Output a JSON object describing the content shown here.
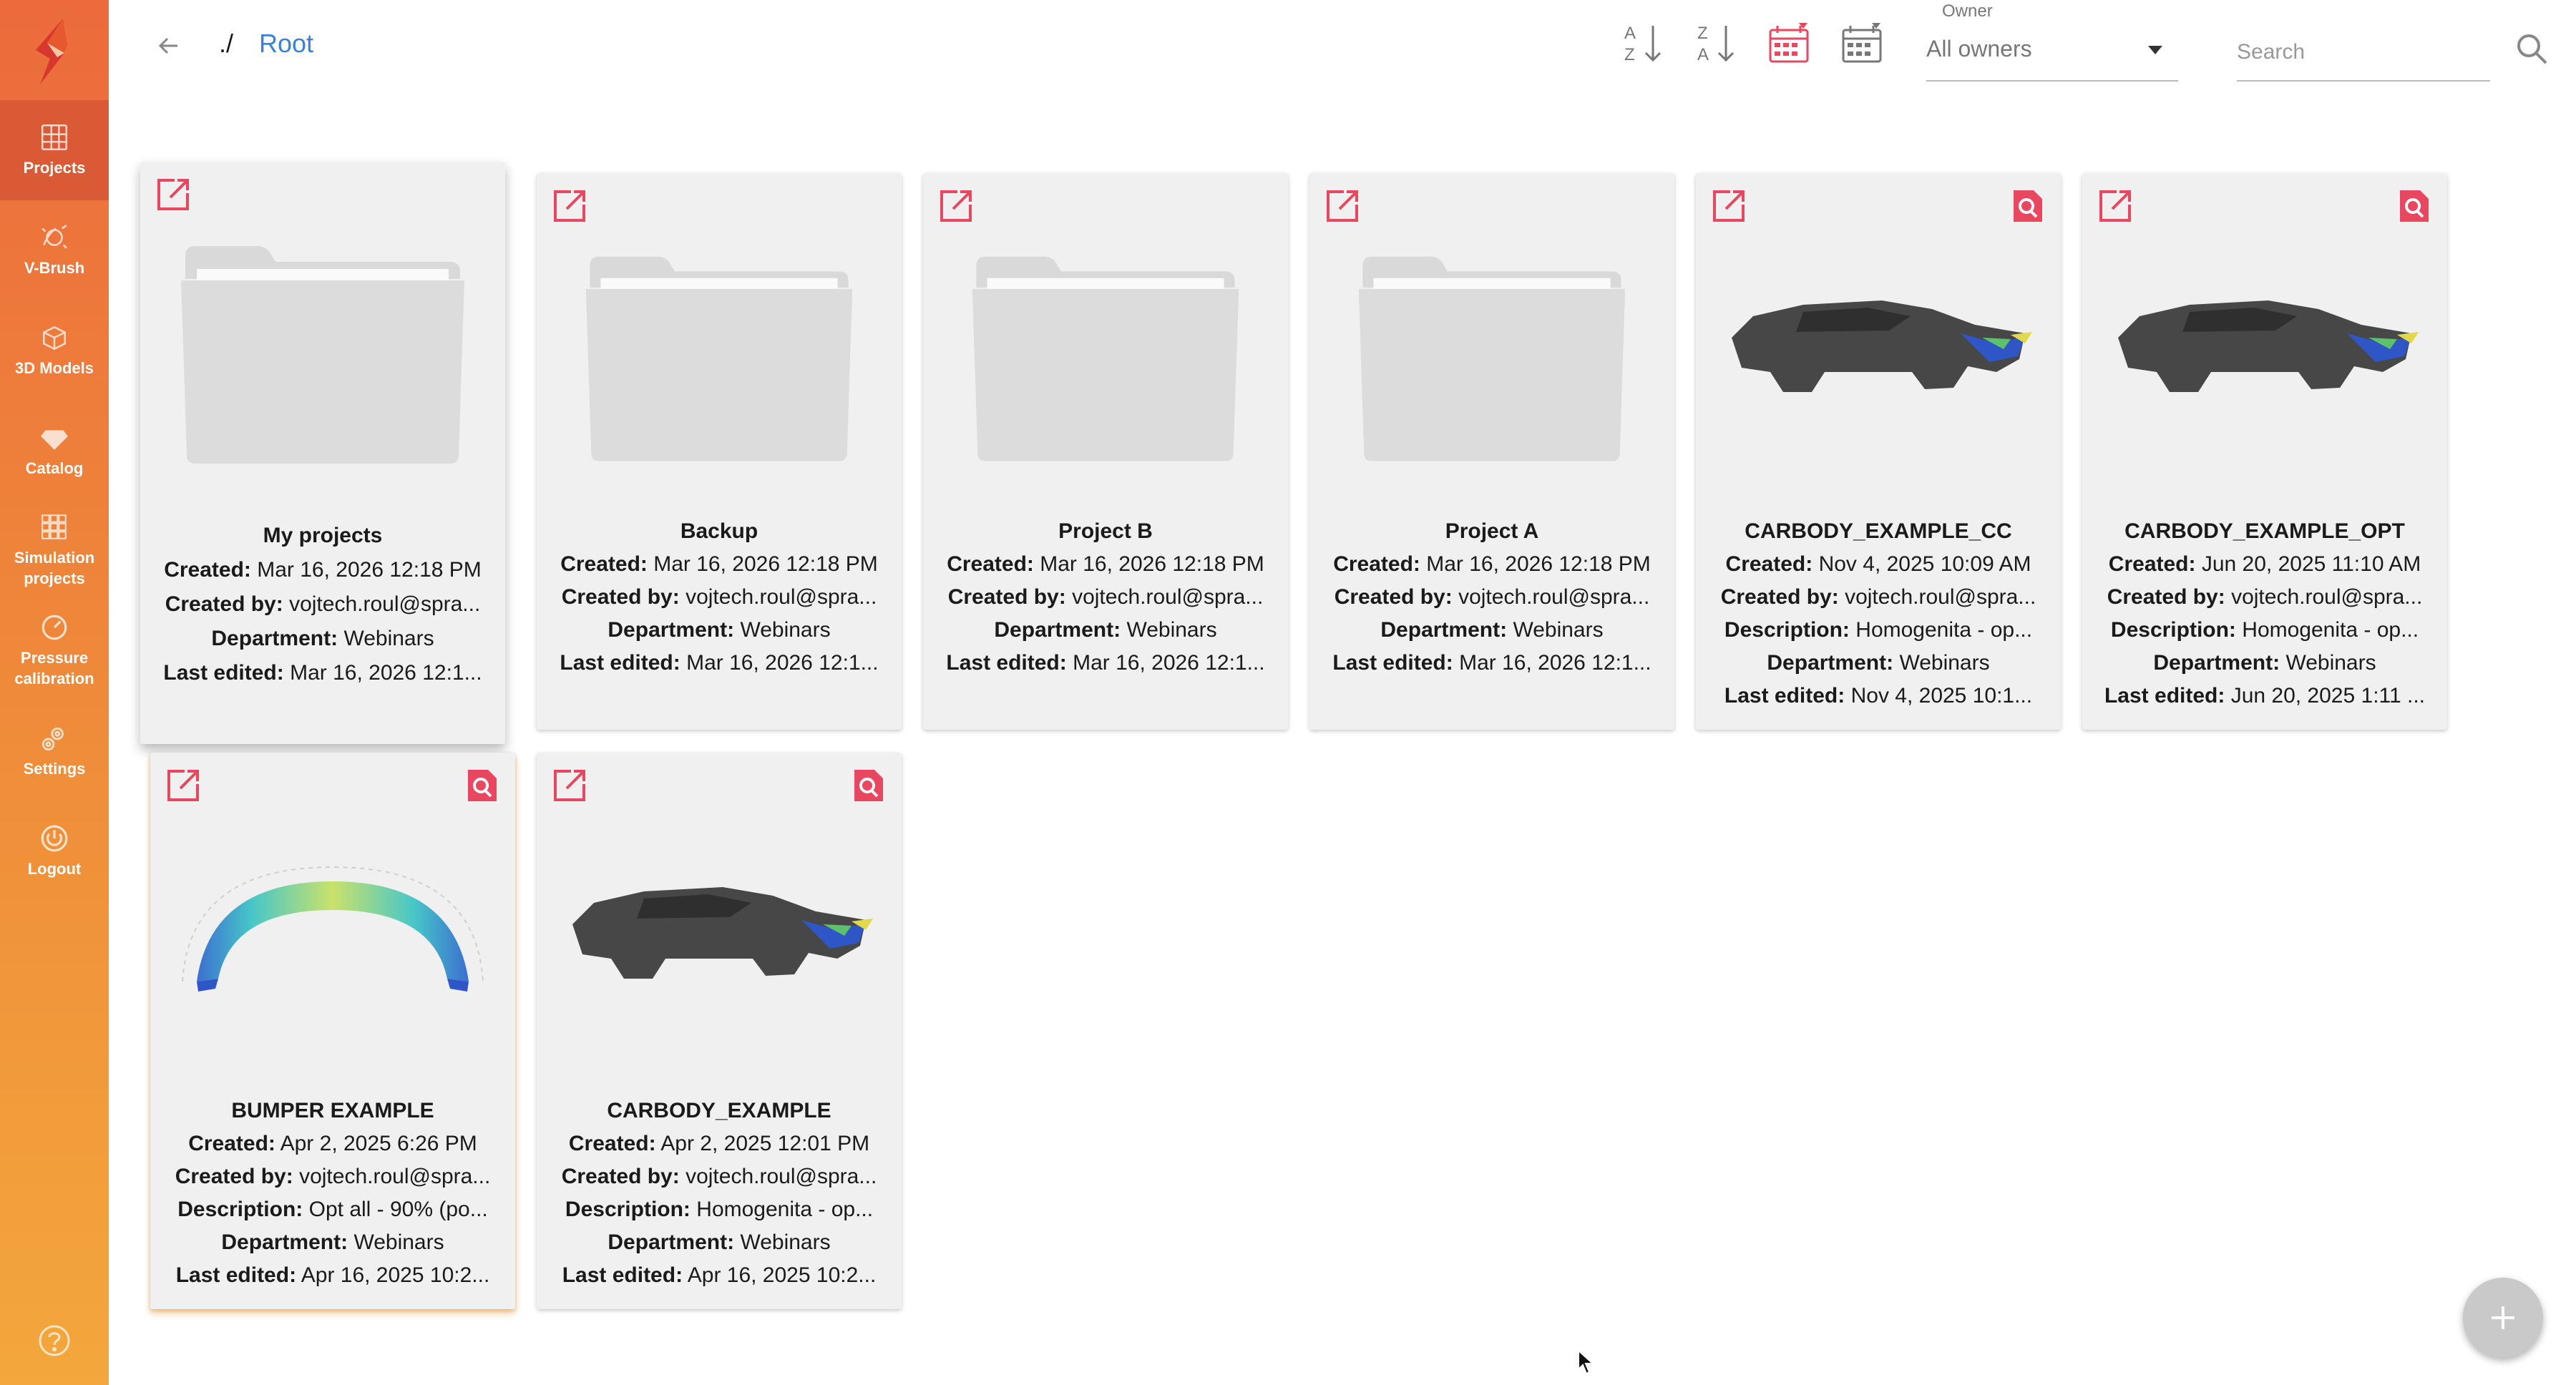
{
  "sidebar": {
    "items": [
      {
        "label": "Projects",
        "icon": "grid-icon",
        "active": true
      },
      {
        "label": "V-Brush",
        "icon": "brush-icon"
      },
      {
        "label": "3D Models",
        "icon": "cube-icon"
      },
      {
        "label": "Catalog",
        "icon": "diamond-icon"
      },
      {
        "label": "Simulation projects",
        "icon": "simulation-grid-icon"
      },
      {
        "label": "Pressure calibration",
        "icon": "gauge-icon"
      },
      {
        "label": "Settings",
        "icon": "gear-icon"
      },
      {
        "label": "Logout",
        "icon": "power-icon"
      }
    ]
  },
  "breadcrumb": {
    "separator": "./",
    "root": "Root"
  },
  "toolbar": {
    "sort_az": "sort-az-icon",
    "sort_za": "sort-za-icon",
    "sort_date_desc": "calendar-sort-down-icon",
    "sort_date_asc": "calendar-sort-up-icon"
  },
  "owner": {
    "label": "Owner",
    "value": "All owners"
  },
  "search": {
    "placeholder": "Search"
  },
  "labels": {
    "created": "Created:",
    "created_by": "Created by:",
    "description": "Description:",
    "department": "Department:",
    "last_edited": "Last edited:"
  },
  "cards": [
    {
      "title": "My projects",
      "created": "Mar 16, 2026 12:18 PM",
      "created_by": "vojtech.roul@spra...",
      "department": "Webinars",
      "last_edited": "Mar 16, 2026 12:1..."
    },
    {
      "title": "Backup",
      "created": "Mar 16, 2026 12:18 PM",
      "created_by": "vojtech.roul@spra...",
      "department": "Webinars",
      "last_edited": "Mar 16, 2026 12:1..."
    },
    {
      "title": "Project B",
      "created": "Mar 16, 2026 12:18 PM",
      "created_by": "vojtech.roul@spra...",
      "department": "Webinars",
      "last_edited": "Mar 16, 2026 12:1..."
    },
    {
      "title": "Project A",
      "created": "Mar 16, 2026 12:18 PM",
      "created_by": "vojtech.roul@spra...",
      "department": "Webinars",
      "last_edited": "Mar 16, 2026 12:1..."
    },
    {
      "title": "CARBODY_EXAMPLE_CC",
      "created": "Nov 4, 2025 10:09 AM",
      "created_by": "vojtech.roul@spra...",
      "description": "Homogenita - op...",
      "department": "Webinars",
      "last_edited": "Nov 4, 2025 10:1..."
    },
    {
      "title": "CARBODY_EXAMPLE_OPT",
      "created": "Jun 20, 2025 11:10 AM",
      "created_by": "vojtech.roul@spra...",
      "description": "Homogenita - op...",
      "department": "Webinars",
      "last_edited": "Jun 20, 2025 1:11 ..."
    },
    {
      "title": "BUMPER EXAMPLE",
      "created": "Apr 2, 2025 6:26 PM",
      "created_by": "vojtech.roul@spra...",
      "description": "Opt all - 90% (po...",
      "department": "Webinars",
      "last_edited": "Apr 16, 2025 10:2..."
    },
    {
      "title": "CARBODY_EXAMPLE",
      "created": "Apr 2, 2025 12:01 PM",
      "created_by": "vojtech.roul@spra...",
      "description": "Homogenita - op...",
      "department": "Webinars",
      "last_edited": "Apr 16, 2025 10:2..."
    }
  ],
  "colors": {
    "accent": "#ee6b3c",
    "icon_red": "#e8475f",
    "link": "#3b82d6"
  }
}
